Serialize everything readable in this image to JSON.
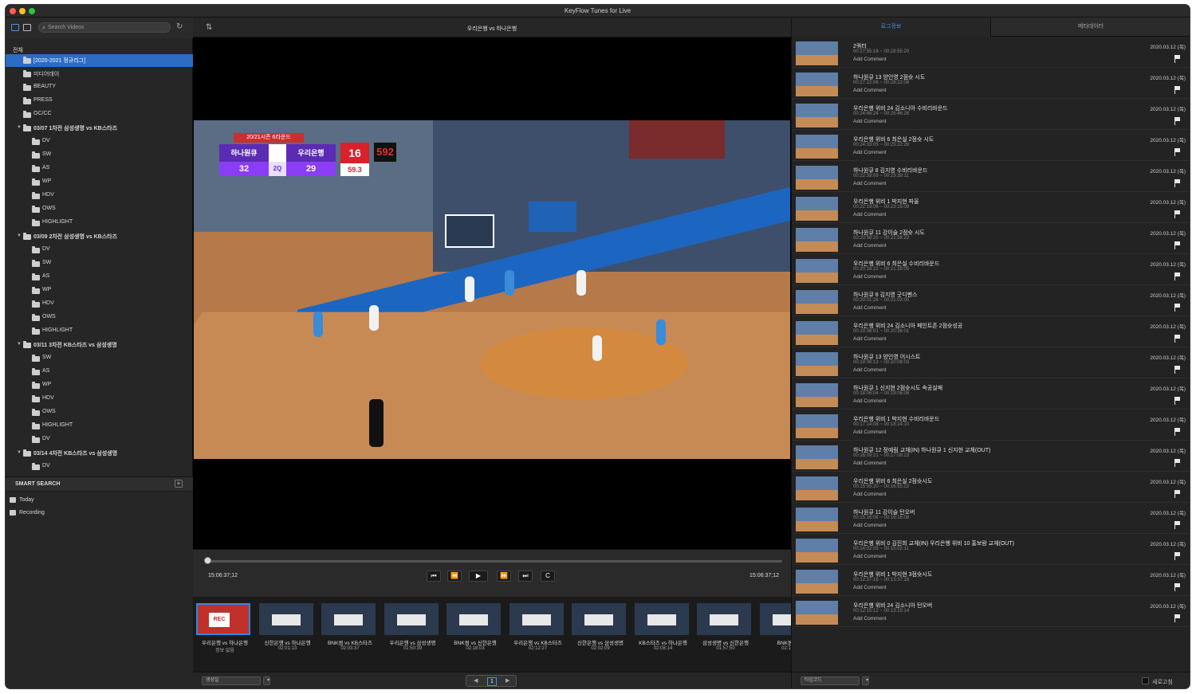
{
  "window": {
    "title": "KeyFlow Tunes for Live"
  },
  "sidebar": {
    "search_placeholder": "Search Videos",
    "root_label": "전체",
    "items": [
      {
        "label": "[2020-2021 정규리그]",
        "selected": true,
        "indent": 0,
        "expand": false
      },
      {
        "label": "미디어데이",
        "indent": 0
      },
      {
        "label": "BEAUTY",
        "indent": 0
      },
      {
        "label": "PRESS",
        "indent": 0
      },
      {
        "label": "OC/CC",
        "indent": 0
      },
      {
        "label": "03/07 1차전 삼성생명 vs KB스타즈",
        "indent": 0,
        "expand": true,
        "bold": true
      },
      {
        "label": "DV",
        "indent": 1
      },
      {
        "label": "SW",
        "indent": 1
      },
      {
        "label": "AS",
        "indent": 1
      },
      {
        "label": "WP",
        "indent": 1
      },
      {
        "label": "HDV",
        "indent": 1
      },
      {
        "label": "OWS",
        "indent": 1
      },
      {
        "label": "HIGHLIGHT",
        "indent": 1
      },
      {
        "label": "03/09 2차전 삼성생명 vs KB스타즈",
        "indent": 0,
        "expand": true,
        "bold": true
      },
      {
        "label": "DV",
        "indent": 1
      },
      {
        "label": "SW",
        "indent": 1
      },
      {
        "label": "AS",
        "indent": 1
      },
      {
        "label": "WP",
        "indent": 1
      },
      {
        "label": "HDV",
        "indent": 1
      },
      {
        "label": "OWS",
        "indent": 1
      },
      {
        "label": "HIGHLIGHT",
        "indent": 1
      },
      {
        "label": "03/11 3차전 KB스타즈 vs 삼성생명",
        "indent": 0,
        "expand": true,
        "bold": true
      },
      {
        "label": "SW",
        "indent": 1
      },
      {
        "label": "AS",
        "indent": 1
      },
      {
        "label": "WP",
        "indent": 1
      },
      {
        "label": "HDV",
        "indent": 1
      },
      {
        "label": "OWS",
        "indent": 1
      },
      {
        "label": "HIGHLIGHT",
        "indent": 1
      },
      {
        "label": "DV",
        "indent": 1
      },
      {
        "label": "03/14 4차전 KB스타즈 vs 삼성생명",
        "indent": 0,
        "expand": true,
        "bold": true
      },
      {
        "label": "DV",
        "indent": 1
      }
    ],
    "smart_search": {
      "title": "SMART SEARCH",
      "add_label": "+",
      "items": [
        {
          "label": "Today"
        },
        {
          "label": "Recording"
        }
      ]
    }
  },
  "player": {
    "title": "우리은행 vs 하나은행",
    "timecode_left": "15:06:37;12",
    "timecode_right": "15:06:37;12",
    "scoreboard": {
      "top_label": "20/21시즌 6라운드",
      "team1": "하나원큐",
      "score1": "32",
      "quarter": "2Q",
      "team2": "우리은행",
      "score2": "29",
      "shot_clock": "16",
      "game_time": "59.3",
      "arena_clock": "592"
    },
    "controls": {
      "to_start": "⏮",
      "rewind": "⏪",
      "play": "▶",
      "forward": "⏩",
      "to_end": "⏭",
      "clip": "C"
    }
  },
  "clips": [
    {
      "name": "우리은행 vs 하나은행",
      "duration": "정보 없음",
      "selected": true,
      "badge": "REC"
    },
    {
      "name": "신한은행 vs 하나은행",
      "duration": "02:01:13"
    },
    {
      "name": "BNK썸 vs KB스타즈",
      "duration": "02:03:37"
    },
    {
      "name": "우리은행 vs 삼성생명",
      "duration": "01:50:39"
    },
    {
      "name": "BNK썸 vs 신한은행",
      "duration": "02:18:03"
    },
    {
      "name": "우리은행 vs KB스타즈",
      "duration": "02:12:27"
    },
    {
      "name": "신한은행 vs 삼성생명",
      "duration": "02:02:09"
    },
    {
      "name": "KB스타즈 vs 하나은행",
      "duration": "02:08:14"
    },
    {
      "name": "삼성생명 vs 신한은행",
      "duration": "01:57:50"
    },
    {
      "name": "BNK썸 vs",
      "duration": "02:15:"
    }
  ],
  "bottom": {
    "sort_select": "생성일",
    "page": "1",
    "prev": "◀",
    "next": "▶"
  },
  "right": {
    "tab_active": "로그정보",
    "tab_other": "메타데이터",
    "logs": [
      {
        "title": "2쿼터",
        "time": "00:27:55:18 ~ 00:28:55:20",
        "comment": "Add Comment",
        "date": "2020.03.12 (목)"
      },
      {
        "title": "하나원큐 13 양인영 2점슛 시도",
        "time": "00:27:22:06 ~ 00:28:22:08",
        "comment": "Add Comment",
        "date": "2020.03.12 (목)"
      },
      {
        "title": "우리은행 위비 24 김소니아 수비리바운드",
        "time": "00:24:46:24 ~ 00:25:46:26",
        "comment": "Add Comment",
        "date": "2020.03.12 (목)"
      },
      {
        "title": "우리은행 위비 6 최은실 2점슛 시도",
        "time": "00:24:33:05 ~ 00:25:22:28",
        "comment": "Add Comment",
        "date": "2020.03.12 (목)"
      },
      {
        "title": "하나원큐 8 김지영 수비리바운드",
        "time": "00:22:39:09 ~ 00:23:39:11",
        "comment": "Add Comment",
        "date": "2020.03.12 (목)"
      },
      {
        "title": "우리은행 위비 1 박지현 파울",
        "time": "00:22:19:06 ~ 00:23:15:09",
        "comment": "Add Comment",
        "date": "2020.03.12 (목)"
      },
      {
        "title": "하나원큐 11 강이슬 2점슛 시도",
        "time": "00:20:58:20 ~ 00:21:58:22",
        "comment": "Add Comment",
        "date": "2020.03.12 (목)"
      },
      {
        "title": "우리은행 위비 6 최은실 수비리바운드",
        "time": "00:20:16:22 ~ 00:21:16:05",
        "comment": "Add Comment",
        "date": "2020.03.12 (목)"
      },
      {
        "title": "하나원큐 8 김지영 굿디펜스",
        "time": "00:20:01:28 ~ 00:21:02:00",
        "comment": "Add Comment",
        "date": "2020.03.12 (목)"
      },
      {
        "title": "우리은행 위비 24 김소니아 페인트존 2점슛성공",
        "time": "00:19:36:01 ~ 00:20:36:01",
        "comment": "Add Comment",
        "date": "2020.03.12 (목)"
      },
      {
        "title": "하나원큐 13 양인영 어시스트",
        "time": "00:19:08:13 ~ 00:20:08:03",
        "comment": "Add Comment",
        "date": "2020.03.12 (목)"
      },
      {
        "title": "하나원큐 1 신지현 2점슛시도 속공실패",
        "time": "00:18:06:04 ~ 00:19:06:06",
        "comment": "Add Comment",
        "date": "2020.03.12 (목)"
      },
      {
        "title": "우리은행 위비 1 박지현 수비리바운드",
        "time": "00:17:14:08 ~ 00:18:14:10",
        "comment": "Add Comment",
        "date": "2020.03.12 (목)"
      },
      {
        "title": "하나원큐 12 정예림 교체(IN) 하나원큐 1 신지현 교체(OUT)",
        "time": "00:16:09:21 ~ 00:17:09:23",
        "comment": "Add Comment",
        "date": "2020.03.12 (목)"
      },
      {
        "title": "우리은행 위비 6 최은실 2점슛시도",
        "time": "00:15:55:20 ~ 00:16:55:22",
        "comment": "Add Comment",
        "date": "2020.03.12 (목)"
      },
      {
        "title": "하나원큐 11 강이슬 턴오버",
        "time": "00:15:16:06 ~ 00:16:16:08",
        "comment": "Add Comment",
        "date": "2020.03.12 (목)"
      },
      {
        "title": "우리은행 위비 0 김진희 교체(IN) 우리은행 위비 10 홍보람 교체(OUT)",
        "time": "00:14:02:09 ~ 00:15:02:11",
        "comment": "Add Comment",
        "date": "2020.03.12 (목)"
      },
      {
        "title": "우리은행 위비 1 박지현 3점슛시도",
        "time": "00:12:37:16 ~ 00:13:37:18",
        "comment": "Add Comment",
        "date": "2020.03.12 (목)"
      },
      {
        "title": "우리은행 위비 24 김소니아 턴오버",
        "time": "00:12:15:12 ~ 00:13:15:14",
        "comment": "Add Comment",
        "date": "2020.03.12 (목)"
      }
    ],
    "bottom_select": "타임코드",
    "checkbox_label": "새로고침"
  }
}
